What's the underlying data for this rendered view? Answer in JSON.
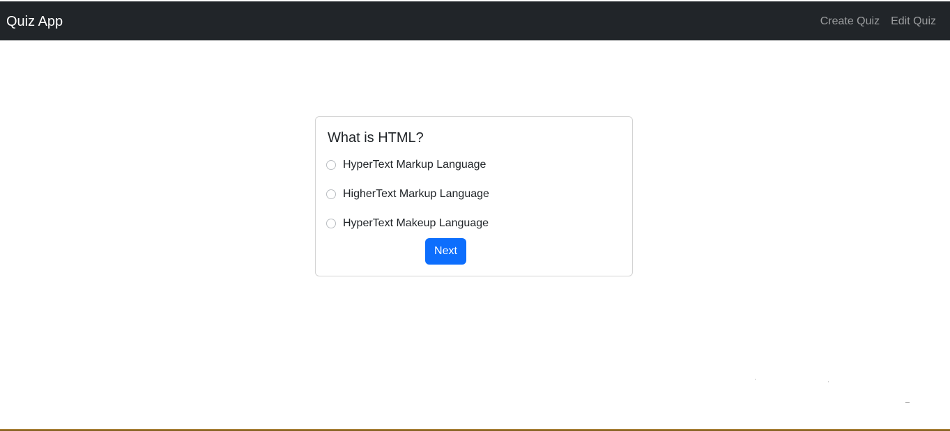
{
  "navbar": {
    "brand": "Quiz App",
    "links": [
      "Create Quiz",
      "Edit Quiz"
    ]
  },
  "quiz": {
    "question": "What is HTML?",
    "options": [
      "HyperText Markup Language",
      "HigherText Markup Language",
      "HyperText Makeup Language"
    ],
    "next_label": "Next"
  },
  "colors": {
    "navbar_bg": "#212529",
    "primary_button": "#0d6efd",
    "bottom_bar": "#b58b3c"
  }
}
